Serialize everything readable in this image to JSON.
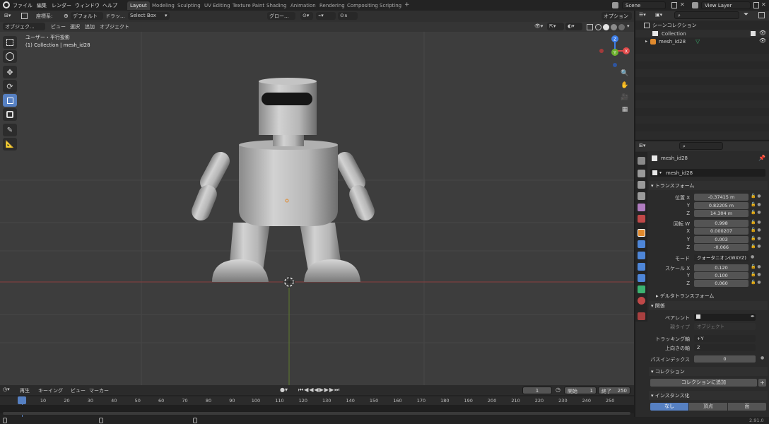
{
  "menus": [
    "ファイル",
    "編集",
    "レンダー",
    "ウィンドウ",
    "ヘルプ"
  ],
  "workspaces": [
    {
      "label": "Layout",
      "active": true
    },
    {
      "label": "Modeling",
      "active": false
    },
    {
      "label": "Sculpting",
      "active": false
    },
    {
      "label": "UV Editing",
      "active": false
    },
    {
      "label": "Texture Paint",
      "active": false
    },
    {
      "label": "Shading",
      "active": false
    },
    {
      "label": "Animation",
      "active": false
    },
    {
      "label": "Rendering",
      "active": false
    },
    {
      "label": "Compositing",
      "active": false
    },
    {
      "label": "Scripting",
      "active": false
    }
  ],
  "add_workspace": "+",
  "scene": "Scene",
  "view_layer": "View Layer",
  "tool_header": {
    "coord_label": "座標系:",
    "coord_value": "デフォルト",
    "drag_label": "ドラッ...",
    "select_box": "Select Box",
    "orientation": "グロー...",
    "options": "オプション"
  },
  "vp_header": {
    "mode": "オブジェク...",
    "view": "ビュー",
    "select": "選択",
    "add": "追加",
    "object": "オブジェクト"
  },
  "viewport_info": {
    "view_name": "ユーザー・平行投影",
    "collection": "(1) Collection | mesh_id28"
  },
  "gizmo": {
    "z": "Z",
    "x": "X",
    "y": "Y"
  },
  "outliner": {
    "scene_collection": "シーンコレクション",
    "collection": "Collection",
    "object": "mesh_id28"
  },
  "properties": {
    "object_name": "mesh_id28",
    "object_field": "mesh_id28",
    "transform_header": "トランスフォーム",
    "location_label": "位置 X",
    "location": [
      "-0.37415 m",
      "0.82205 m",
      "14.304 m"
    ],
    "rotation_label": "回転 W",
    "rotation": [
      "0.998",
      "0.000207",
      "0.003",
      "-0.066"
    ],
    "axis_y": "Y",
    "axis_z": "Z",
    "axis_x": "X",
    "mode_label": "モード",
    "mode_value": "クォータニオン(WXYZ)",
    "scale_label": "スケール X",
    "scale": [
      "0.120",
      "0.100",
      "0.060"
    ],
    "delta_header": "デルタトランスフォーム",
    "relations_header": "関係",
    "parent_label": "ペアレント",
    "parent_type_label": "親タイプ",
    "parent_type_value": "オブジェクト",
    "tracking_label": "トラッキング軸",
    "tracking_value": "+Y",
    "up_label": "上向きの軸",
    "up_value": "Z",
    "pass_label": "パスインデックス",
    "pass_value": "0",
    "collections_header": "コレクション",
    "add_to_collection": "コレクションに追加",
    "instancing_header": "インスタンス化",
    "inst_none": "なし",
    "inst_verts": "頂点",
    "inst_faces": "面"
  },
  "timeline": {
    "playback": "再生",
    "keying": "キーイング",
    "view": "ビュー",
    "marker": "マーカー",
    "current_frame": "1",
    "start_label": "開始",
    "start": "1",
    "end_label": "終了",
    "end": "250",
    "ticks": [
      "1",
      "10",
      "20",
      "30",
      "40",
      "50",
      "60",
      "70",
      "80",
      "90",
      "100",
      "110",
      "120",
      "130",
      "140",
      "150",
      "160",
      "170",
      "180",
      "190",
      "200",
      "210",
      "220",
      "230",
      "240",
      "250"
    ]
  },
  "version": "2.91.0",
  "colors": {
    "accent": "#5680c2",
    "axis_x": "#e24a4a",
    "axis_y": "#6eb12e",
    "axis_z": "#3d7ee8"
  }
}
